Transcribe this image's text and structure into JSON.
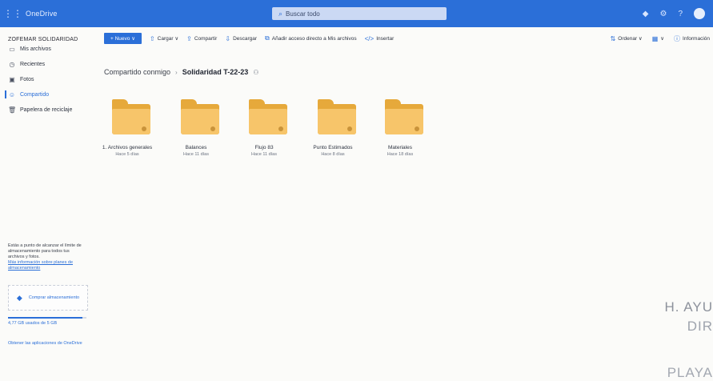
{
  "topbar": {
    "app_name": "OneDrive",
    "search_placeholder": "Buscar todo"
  },
  "leftnav": {
    "user_name": "ZOFEMAR SOLIDARIDAD",
    "items": [
      {
        "label": "Mis archivos",
        "icon": "folder-icon"
      },
      {
        "label": "Recientes",
        "icon": "clock-icon"
      },
      {
        "label": "Fotos",
        "icon": "image-icon"
      },
      {
        "label": "Compartido",
        "icon": "people-icon",
        "active": true
      },
      {
        "label": "Papelera de reciclaje",
        "icon": "trash-icon"
      }
    ],
    "storage_text": "Estás a punto de alcanzar el límite de almacenamiento para todos tus archivos y fotos.",
    "storage_link": "Más información sobre planes de almacenamiento",
    "buy_storage": "Comprar almacenamiento",
    "storage_used": "4,77 GB usados de 5 GB",
    "storage_fraction": 0.954,
    "get_apps": "Obtener las aplicaciones de OneDrive"
  },
  "commandbar": {
    "new_label": "+ Nuevo ∨",
    "upload_label": "Cargar ∨",
    "share_label": "Compartir",
    "download_label": "Descargar",
    "add_shortcut_label": "Añadir acceso directo a Mis archivos",
    "embed_label": "Insertar",
    "sort_label": "Ordenar ∨",
    "view_label": "∨",
    "info_label": "Información"
  },
  "breadcrumb": {
    "parent": "Compartido conmigo",
    "current": "Solidaridad T-22-23"
  },
  "folders": [
    {
      "name": "1. Archivos generales",
      "date": "Hace 5 días"
    },
    {
      "name": "Balances",
      "date": "Hace 11 días"
    },
    {
      "name": "Flujo 83",
      "date": "Hace 11 días"
    },
    {
      "name": "Punto Estimados",
      "date": "Hace 8 días"
    },
    {
      "name": "Materiales",
      "date": "Hace 18 días"
    }
  ],
  "stamp": {
    "line1": "H. AYU",
    "line2": "DIR",
    "line3": "PLAYA"
  },
  "colors": {
    "brand_blue": "#2b6fd8",
    "folder_yellow": "#f7c56a"
  }
}
